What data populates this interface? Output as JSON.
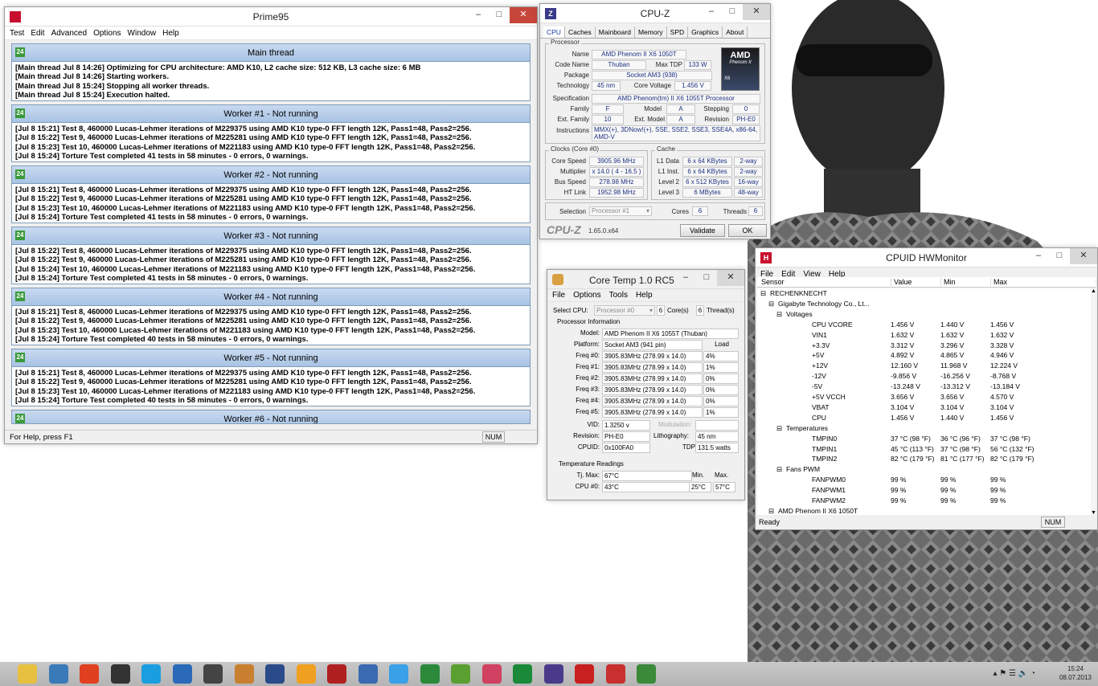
{
  "prime95": {
    "title": "Prime95",
    "menu": [
      "Test",
      "Edit",
      "Advanced",
      "Options",
      "Window",
      "Help"
    ],
    "threads": [
      {
        "title": "Main thread",
        "lines": [
          "[Main thread Jul 8 14:26] Optimizing for CPU architecture: AMD K10, L2 cache size: 512 KB, L3 cache size: 6 MB",
          "[Main thread Jul 8 14:26] Starting workers.",
          "[Main thread Jul 8 15:24] Stopping all worker threads.",
          "[Main thread Jul 8 15:24] Execution halted."
        ]
      },
      {
        "title": "Worker #1 - Not running",
        "lines": [
          "[Jul 8 15:21] Test 8, 460000 Lucas-Lehmer iterations of M229375 using AMD K10 type-0 FFT length 12K, Pass1=48, Pass2=256.",
          "[Jul 8 15:22] Test 9, 460000 Lucas-Lehmer iterations of M225281 using AMD K10 type-0 FFT length 12K, Pass1=48, Pass2=256.",
          "[Jul 8 15:23] Test 10, 460000 Lucas-Lehmer iterations of M221183 using AMD K10 type-0 FFT length 12K, Pass1=48, Pass2=256.",
          "[Jul 8 15:24] Torture Test completed 41 tests in 58 minutes - 0 errors, 0 warnings."
        ]
      },
      {
        "title": "Worker #2 - Not running",
        "lines": [
          "[Jul 8 15:21] Test 8, 460000 Lucas-Lehmer iterations of M229375 using AMD K10 type-0 FFT length 12K, Pass1=48, Pass2=256.",
          "[Jul 8 15:22] Test 9, 460000 Lucas-Lehmer iterations of M225281 using AMD K10 type-0 FFT length 12K, Pass1=48, Pass2=256.",
          "[Jul 8 15:23] Test 10, 460000 Lucas-Lehmer iterations of M221183 using AMD K10 type-0 FFT length 12K, Pass1=48, Pass2=256.",
          "[Jul 8 15:24] Torture Test completed 41 tests in 58 minutes - 0 errors, 0 warnings."
        ]
      },
      {
        "title": "Worker #3 - Not running",
        "lines": [
          "[Jul 8 15:22] Test 8, 460000 Lucas-Lehmer iterations of M229375 using AMD K10 type-0 FFT length 12K, Pass1=48, Pass2=256.",
          "[Jul 8 15:22] Test 9, 460000 Lucas-Lehmer iterations of M225281 using AMD K10 type-0 FFT length 12K, Pass1=48, Pass2=256.",
          "[Jul 8 15:24] Test 10, 460000 Lucas-Lehmer iterations of M221183 using AMD K10 type-0 FFT length 12K, Pass1=48, Pass2=256.",
          "[Jul 8 15:24] Torture Test completed 41 tests in 58 minutes - 0 errors, 0 warnings."
        ]
      },
      {
        "title": "Worker #4 - Not running",
        "lines": [
          "[Jul 8 15:21] Test 8, 460000 Lucas-Lehmer iterations of M229375 using AMD K10 type-0 FFT length 12K, Pass1=48, Pass2=256.",
          "[Jul 8 15:22] Test 9, 460000 Lucas-Lehmer iterations of M225281 using AMD K10 type-0 FFT length 12K, Pass1=48, Pass2=256.",
          "[Jul 8 15:23] Test 10, 460000 Lucas-Lehmer iterations of M221183 using AMD K10 type-0 FFT length 12K, Pass1=48, Pass2=256.",
          "[Jul 8 15:24] Torture Test completed 40 tests in 58 minutes - 0 errors, 0 warnings."
        ]
      },
      {
        "title": "Worker #5 - Not running",
        "lines": [
          "[Jul 8 15:21] Test 8, 460000 Lucas-Lehmer iterations of M229375 using AMD K10 type-0 FFT length 12K, Pass1=48, Pass2=256.",
          "[Jul 8 15:22] Test 9, 460000 Lucas-Lehmer iterations of M225281 using AMD K10 type-0 FFT length 12K, Pass1=48, Pass2=256.",
          "[Jul 8 15:23] Test 10, 460000 Lucas-Lehmer iterations of M221183 using AMD K10 type-0 FFT length 12K, Pass1=48, Pass2=256.",
          "[Jul 8 15:24] Torture Test completed 40 tests in 58 minutes - 0 errors, 0 warnings."
        ]
      },
      {
        "title": "Worker #6 - Not running",
        "lines": []
      }
    ],
    "status": "For Help, press F1",
    "num": "NUM"
  },
  "cpuz": {
    "title": "CPU-Z",
    "tabs": [
      "CPU",
      "Caches",
      "Mainboard",
      "Memory",
      "SPD",
      "Graphics",
      "About"
    ],
    "processor_group": "Processor",
    "name_label": "Name",
    "name": "AMD Phenom II X6 1050T",
    "codename_label": "Code Name",
    "codename": "Thuban",
    "maxtdp_label": "Max TDP",
    "maxtdp": "133 W",
    "package_label": "Package",
    "package": "Socket AM3 (938)",
    "technology_label": "Technology",
    "technology": "45 nm",
    "voltage_label": "Core Voltage",
    "voltage": "1.456 V",
    "spec_label": "Specification",
    "spec": "AMD Phenom(tm) II X6 1055T Processor",
    "family_label": "Family",
    "family": "F",
    "model_label": "Model",
    "model": "A",
    "stepping_label": "Stepping",
    "stepping": "0",
    "extfamily_label": "Ext. Family",
    "extfamily": "10",
    "extmodel_label": "Ext. Model",
    "extmodel": "A",
    "revision_label": "Revision",
    "revision": "PH-E0",
    "instr_label": "Instructions",
    "instr": "MMX(+), 3DNow!(+), SSE, SSE2, SSE3, SSE4A, x86-64, AMD-V",
    "clocks_group": "Clocks (Core #0)",
    "corespeed_label": "Core Speed",
    "corespeed": "3905.96 MHz",
    "multiplier_label": "Multiplier",
    "multiplier": "x 14.0 ( 4 - 16.5 )",
    "busspeed_label": "Bus Speed",
    "busspeed": "278.98 MHz",
    "htlink_label": "HT Link",
    "htlink": "1952.98 MHz",
    "cache_group": "Cache",
    "l1d_label": "L1 Data",
    "l1d": "6 x 64 KBytes",
    "l1d_way": "2-way",
    "l1i_label": "L1 Inst.",
    "l1i": "6 x 64 KBytes",
    "l1i_way": "2-way",
    "l2_label": "Level 2",
    "l2": "6 x 512 KBytes",
    "l2_way": "16-way",
    "l3_label": "Level 3",
    "l3": "6 MBytes",
    "l3_way": "48-way",
    "selection_label": "Selection",
    "selection": "Processor #1",
    "cores_label": "Cores",
    "cores": "6",
    "threads_label": "Threads",
    "threads": "6",
    "brand": "CPU-Z",
    "version": "1.65.0.x64",
    "validate": "Validate",
    "ok": "OK",
    "logo_top": "AMD",
    "logo_sub": "Phenom II",
    "logo_x6": "X6"
  },
  "coretemp": {
    "title": "Core Temp 1.0 RC5",
    "menu": [
      "File",
      "Options",
      "Tools",
      "Help"
    ],
    "selectcpu_label": "Select CPU:",
    "selectcpu": "Processor #0",
    "cores": "6",
    "cores_label": "Core(s)",
    "threads": "6",
    "threads_label": "Thread(s)",
    "procinfo": "Processor Information",
    "model_label": "Model:",
    "model": "AMD Phenom II X6 1055T (Thuban)",
    "platform_label": "Platform:",
    "platform": "Socket AM3 (941 pin)",
    "load_label": "Load",
    "freqs": [
      {
        "label": "Freq #0:",
        "value": "3905.83MHz (278.99 x 14.0)",
        "load": "4%"
      },
      {
        "label": "Freq #1:",
        "value": "3905.83MHz (278.99 x 14.0)",
        "load": "1%"
      },
      {
        "label": "Freq #2:",
        "value": "3905.83MHz (278.99 x 14.0)",
        "load": "0%"
      },
      {
        "label": "Freq #3:",
        "value": "3905.83MHz (278.99 x 14.0)",
        "load": "0%"
      },
      {
        "label": "Freq #4:",
        "value": "3905.83MHz (278.99 x 14.0)",
        "load": "0%"
      },
      {
        "label": "Freq #5:",
        "value": "3905.83MHz (278.99 x 14.0)",
        "load": "1%"
      }
    ],
    "vid_label": "VID:",
    "vid": "1.3250 v",
    "modulation_label": "Modulation:",
    "revision_label": "Revision:",
    "revision": "PH-E0",
    "litho_label": "Lithography:",
    "litho": "45 nm",
    "cpuid_label": "CPUID:",
    "cpuid": "0x100FA0",
    "tdp_label": "TDP:",
    "tdp": "131.5 watts",
    "temp_title": "Temperature Readings",
    "tjmax_label": "Tj. Max:",
    "tjmax": "67°C",
    "min_label": "Min.",
    "max_label": "Max.",
    "cpu0_label": "CPU #0:",
    "cpu0": "43°C",
    "cpu0_min": "25°C",
    "cpu0_max": "57°C"
  },
  "hwmon": {
    "title": "CPUID HWMonitor",
    "menu": [
      "File",
      "Edit",
      "View",
      "Help"
    ],
    "cols": [
      "Sensor",
      "Value",
      "Min",
      "Max"
    ],
    "rows": [
      {
        "name": "RECHENKNECHT",
        "value": "",
        "min": "",
        "max": ""
      },
      {
        "name": "Gigabyte Technology Co., Lt...",
        "value": "",
        "min": "",
        "max": ""
      },
      {
        "name": "Voltages",
        "value": "",
        "min": "",
        "max": ""
      },
      {
        "name": "CPU VCORE",
        "value": "1.456 V",
        "min": "1.440 V",
        "max": "1.456 V"
      },
      {
        "name": "VIN1",
        "value": "1.632 V",
        "min": "1.632 V",
        "max": "1.632 V"
      },
      {
        "name": "+3.3V",
        "value": "3.312 V",
        "min": "3.296 V",
        "max": "3.328 V"
      },
      {
        "name": "+5V",
        "value": "4.892 V",
        "min": "4.865 V",
        "max": "4.946 V"
      },
      {
        "name": "+12V",
        "value": "12.160 V",
        "min": "11.968 V",
        "max": "12.224 V"
      },
      {
        "name": "-12V",
        "value": "-9.856 V",
        "min": "-16.256 V",
        "max": "-8.768 V"
      },
      {
        "name": "-5V",
        "value": "-13.248 V",
        "min": "-13.312 V",
        "max": "-13.184 V"
      },
      {
        "name": "+5V VCCH",
        "value": "3.656 V",
        "min": "3.656 V",
        "max": "4.570 V"
      },
      {
        "name": "VBAT",
        "value": "3.104 V",
        "min": "3.104 V",
        "max": "3.104 V"
      },
      {
        "name": "CPU",
        "value": "1.456 V",
        "min": "1.440 V",
        "max": "1.456 V"
      },
      {
        "name": "Temperatures",
        "value": "",
        "min": "",
        "max": ""
      },
      {
        "name": "TMPIN0",
        "value": "37 °C (98 °F)",
        "min": "36 °C (96 °F)",
        "max": "37 °C (98 °F)"
      },
      {
        "name": "TMPIN1",
        "value": "45 °C (113 °F)",
        "min": "37 °C (98 °F)",
        "max": "56 °C (132 °F)"
      },
      {
        "name": "TMPIN2",
        "value": "82 °C (179 °F)",
        "min": "81 °C (177 °F)",
        "max": "82 °C (179 °F)"
      },
      {
        "name": "Fans PWM",
        "value": "",
        "min": "",
        "max": ""
      },
      {
        "name": "FANPWM0",
        "value": "99 %",
        "min": "99 %",
        "max": "99 %"
      },
      {
        "name": "FANPWM1",
        "value": "99 %",
        "min": "99 %",
        "max": "99 %"
      },
      {
        "name": "FANPWM2",
        "value": "99 %",
        "min": "99 %",
        "max": "99 %"
      },
      {
        "name": "AMD Phenom II X6 1050T",
        "value": "",
        "min": "",
        "max": ""
      }
    ],
    "status": "Ready",
    "num": "NUM"
  },
  "taskbar": {
    "time": "15:24",
    "date": "08.07.2013",
    "icons": [
      "file-explorer-icon",
      "network-icon",
      "chrome-icon",
      "steam-icon",
      "skype-icon",
      "thunder-icon",
      "monitor-icon",
      "game-icon",
      "speaker-icon",
      "timer-icon",
      "stripes-icon",
      "sync-icon",
      "dropbox-icon",
      "calculator-icon",
      "utorrent-icon",
      "cleaner-icon",
      "badge-icon",
      "cpuz-icon",
      "flash-icon",
      "coretemp-icon",
      "hwmon-icon"
    ],
    "colors": [
      "#e8c040",
      "#3a7ab8",
      "#e04020",
      "#333333",
      "#1a9ee0",
      "#2a6ab8",
      "#444444",
      "#c88030",
      "#2a4a8a",
      "#f0a020",
      "#b02020",
      "#3a6ab0",
      "#3aa0e8",
      "#2a8a3a",
      "#5aa030",
      "#d04060",
      "#1a8a3a",
      "#4a3a8a",
      "#c82020",
      "#c83030",
      "#3a8a3a"
    ]
  }
}
